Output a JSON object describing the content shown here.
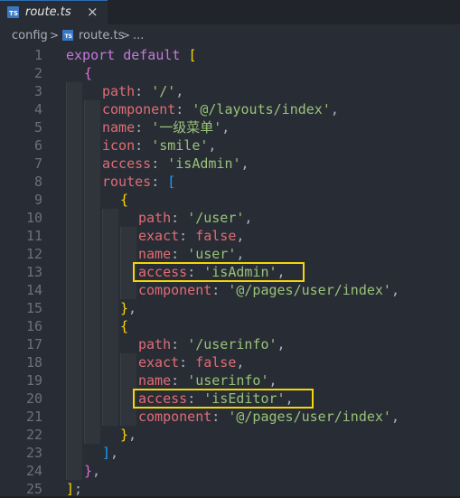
{
  "tab": {
    "label": "route.ts",
    "close": "×",
    "icon": "typescript-file-icon",
    "badge": "TS"
  },
  "breadcrumb": {
    "folder": "config",
    "sep": ">",
    "file": "route.ts",
    "tail": "...",
    "badge": "TS"
  },
  "lines": [
    {
      "n": "1",
      "tokens": [
        [
          "kw",
          "export default "
        ],
        [
          "br1",
          "["
        ]
      ]
    },
    {
      "n": "2",
      "tokens": [
        [
          "br2",
          "{"
        ]
      ]
    },
    {
      "n": "3",
      "tokens": [
        [
          "key",
          "path"
        ],
        [
          "pun",
          ": "
        ],
        [
          "str",
          "'/'"
        ],
        [
          "pun",
          ","
        ]
      ]
    },
    {
      "n": "4",
      "tokens": [
        [
          "key",
          "component"
        ],
        [
          "pun",
          ": "
        ],
        [
          "str",
          "'@/layouts/index'"
        ],
        [
          "pun",
          ","
        ]
      ]
    },
    {
      "n": "5",
      "tokens": [
        [
          "key",
          "name"
        ],
        [
          "pun",
          ": "
        ],
        [
          "str",
          "'一级菜单'"
        ],
        [
          "pun",
          ","
        ]
      ]
    },
    {
      "n": "6",
      "tokens": [
        [
          "key",
          "icon"
        ],
        [
          "pun",
          ": "
        ],
        [
          "str",
          "'smile'"
        ],
        [
          "pun",
          ","
        ]
      ]
    },
    {
      "n": "7",
      "tokens": [
        [
          "key",
          "access"
        ],
        [
          "pun",
          ": "
        ],
        [
          "str",
          "'isAdmin'"
        ],
        [
          "pun",
          ","
        ]
      ]
    },
    {
      "n": "8",
      "tokens": [
        [
          "key",
          "routes"
        ],
        [
          "pun",
          ": "
        ],
        [
          "br3",
          "["
        ]
      ]
    },
    {
      "n": "9",
      "tokens": [
        [
          "br1",
          "{"
        ]
      ]
    },
    {
      "n": "10",
      "tokens": [
        [
          "key",
          "path"
        ],
        [
          "pun",
          ": "
        ],
        [
          "str",
          "'/user'"
        ],
        [
          "pun",
          ","
        ]
      ]
    },
    {
      "n": "11",
      "tokens": [
        [
          "key",
          "exact"
        ],
        [
          "pun",
          ": "
        ],
        [
          "key",
          "false"
        ],
        [
          "pun",
          ","
        ]
      ]
    },
    {
      "n": "12",
      "tokens": [
        [
          "key",
          "name"
        ],
        [
          "pun",
          ": "
        ],
        [
          "str",
          "'user'"
        ],
        [
          "pun",
          ","
        ]
      ]
    },
    {
      "n": "13",
      "tokens": [
        [
          "key",
          "access"
        ],
        [
          "pun",
          ": "
        ],
        [
          "str",
          "'isAdmin'"
        ],
        [
          "pun",
          ","
        ]
      ]
    },
    {
      "n": "14",
      "tokens": [
        [
          "key",
          "component"
        ],
        [
          "pun",
          ": "
        ],
        [
          "str",
          "'@/pages/user/index'"
        ],
        [
          "pun",
          ","
        ]
      ]
    },
    {
      "n": "15",
      "tokens": [
        [
          "br1",
          "}"
        ],
        [
          "pun",
          ","
        ]
      ]
    },
    {
      "n": "16",
      "tokens": [
        [
          "br1",
          "{"
        ]
      ]
    },
    {
      "n": "17",
      "tokens": [
        [
          "key",
          "path"
        ],
        [
          "pun",
          ": "
        ],
        [
          "str",
          "'/userinfo'"
        ],
        [
          "pun",
          ","
        ]
      ]
    },
    {
      "n": "18",
      "tokens": [
        [
          "key",
          "exact"
        ],
        [
          "pun",
          ": "
        ],
        [
          "key",
          "false"
        ],
        [
          "pun",
          ","
        ]
      ]
    },
    {
      "n": "19",
      "tokens": [
        [
          "key",
          "name"
        ],
        [
          "pun",
          ": "
        ],
        [
          "str",
          "'userinfo'"
        ],
        [
          "pun",
          ","
        ]
      ]
    },
    {
      "n": "20",
      "tokens": [
        [
          "key",
          "access"
        ],
        [
          "pun",
          ": "
        ],
        [
          "str",
          "'isEditor'"
        ],
        [
          "pun",
          ","
        ]
      ]
    },
    {
      "n": "21",
      "tokens": [
        [
          "key",
          "component"
        ],
        [
          "pun",
          ": "
        ],
        [
          "str",
          "'@/pages/user/index'"
        ],
        [
          "pun",
          ","
        ]
      ]
    },
    {
      "n": "22",
      "tokens": [
        [
          "br1",
          "}"
        ],
        [
          "pun",
          ","
        ]
      ]
    },
    {
      "n": "23",
      "tokens": [
        [
          "br3",
          "]"
        ],
        [
          "pun",
          ","
        ]
      ]
    },
    {
      "n": "24",
      "tokens": [
        [
          "br2",
          "}"
        ],
        [
          "pun",
          ","
        ]
      ]
    },
    {
      "n": "25",
      "tokens": [
        [
          "br1",
          "]"
        ],
        [
          "pun",
          ";"
        ]
      ]
    }
  ],
  "highlights": [
    13,
    20
  ],
  "colors": {
    "highlight_border": "#f5d60a",
    "background": "#282c34"
  }
}
